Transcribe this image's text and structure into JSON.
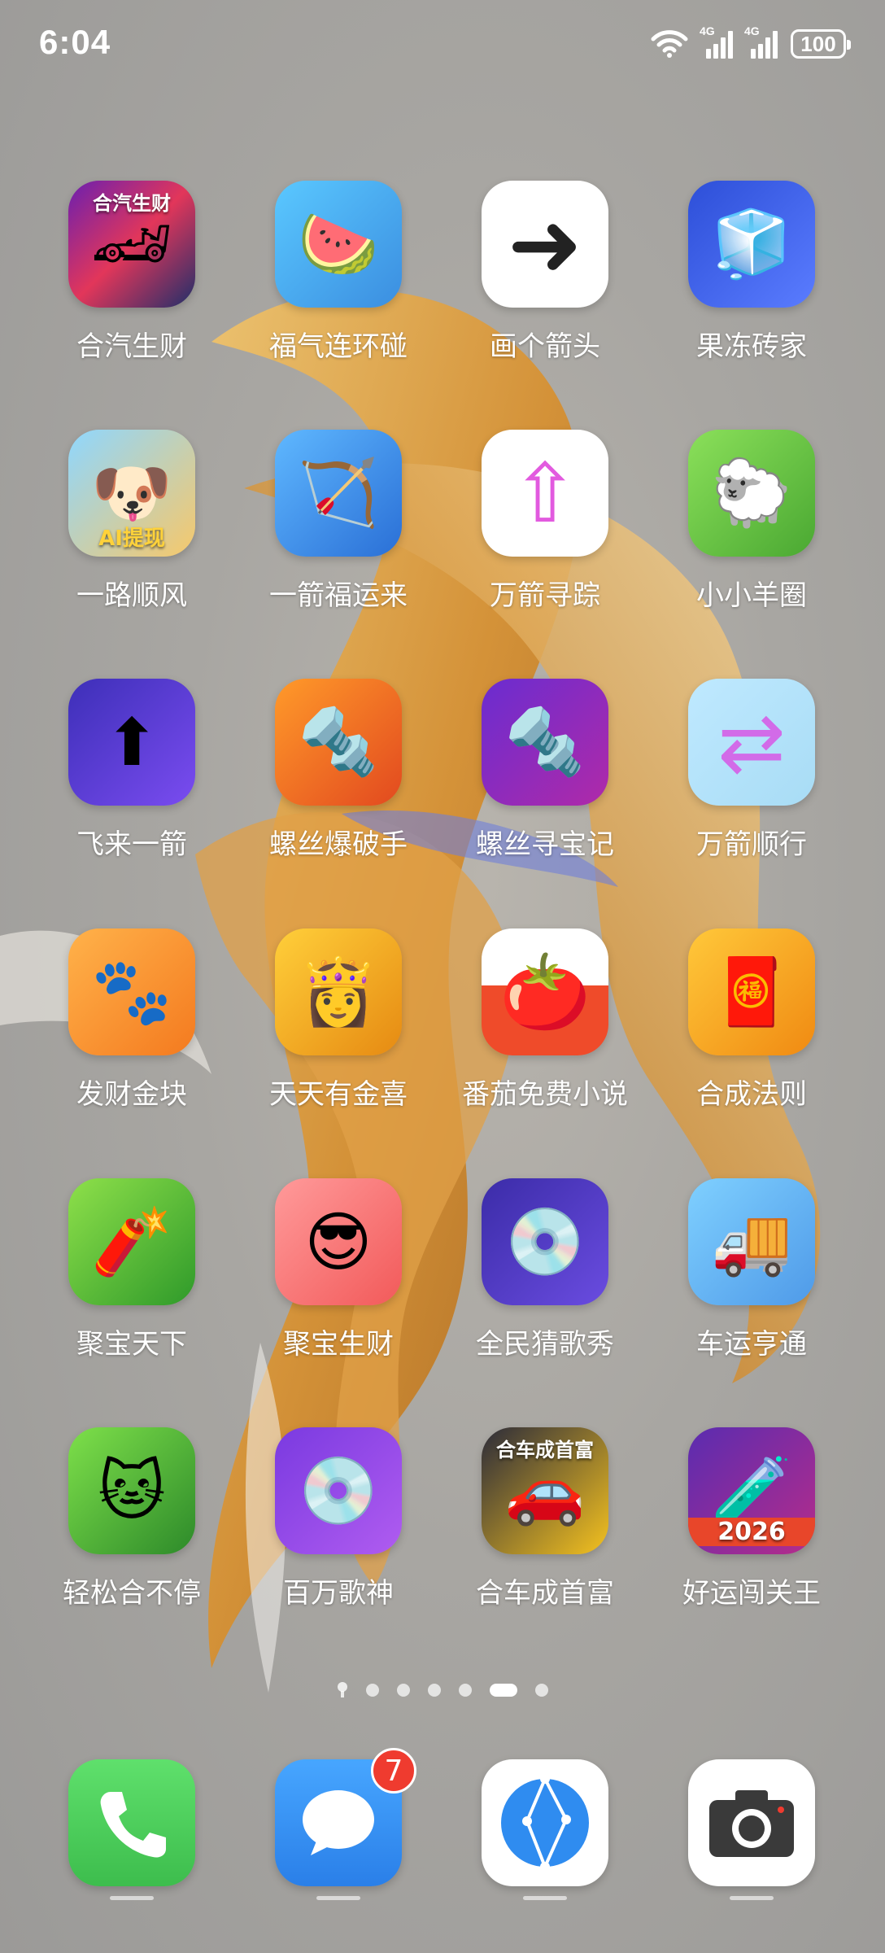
{
  "status": {
    "time": "6:04",
    "network1": "4G",
    "network2": "4G",
    "battery": "100"
  },
  "apps": [
    {
      "label": "合汽生财",
      "icon": "car-racing-icon",
      "icon_text": "合汽生财"
    },
    {
      "label": "福气连环碰",
      "icon": "watermelon-icon"
    },
    {
      "label": "画个箭头",
      "icon": "arrow-maze-icon"
    },
    {
      "label": "果冻砖家",
      "icon": "jelly-cube-icon"
    },
    {
      "label": "一路顺风",
      "icon": "animals-car-icon",
      "icon_text": "AI提现"
    },
    {
      "label": "一箭福运来",
      "icon": "arrow-ring-icon"
    },
    {
      "label": "万箭寻踪",
      "icon": "colorful-arrows-icon"
    },
    {
      "label": "小小羊圈",
      "icon": "sheep-icon"
    },
    {
      "label": "飞来一箭",
      "icon": "yellow-arrow-icon"
    },
    {
      "label": "螺丝爆破手",
      "icon": "screw-blast-icon"
    },
    {
      "label": "螺丝寻宝记",
      "icon": "screw-treasure-icon"
    },
    {
      "label": "万箭顺行",
      "icon": "arrow-grid-icon"
    },
    {
      "label": "发财金块",
      "icon": "paw-block-icon"
    },
    {
      "label": "天天有金喜",
      "icon": "lady-gold-icon"
    },
    {
      "label": "番茄免费小说",
      "icon": "tomato-book-icon"
    },
    {
      "label": "合成法则",
      "icon": "fortune-god-icon"
    },
    {
      "label": "聚宝天下",
      "icon": "fortune-man-icon"
    },
    {
      "label": "聚宝生财",
      "icon": "cool-god-icon"
    },
    {
      "label": "全民猜歌秀",
      "icon": "vinyl-music-icon"
    },
    {
      "label": "车运亨通",
      "icon": "yellow-truck-icon"
    },
    {
      "label": "轻松合不停",
      "icon": "cat-god-icon"
    },
    {
      "label": "百万歌神",
      "icon": "purple-vinyl-icon"
    },
    {
      "label": "合车成首富",
      "icon": "sports-car-icon",
      "icon_text": "合车成首富"
    },
    {
      "label": "好运闯关王",
      "icon": "tubes-2026-icon",
      "icon_text": "2026"
    }
  ],
  "dock": [
    {
      "name": "phone-app",
      "icon": "phone-icon"
    },
    {
      "name": "messages-app",
      "icon": "message-icon",
      "badge": "7"
    },
    {
      "name": "browser-app",
      "icon": "browser-icon"
    },
    {
      "name": "camera-app",
      "icon": "camera-icon"
    }
  ],
  "colors": {
    "dock_phone": "#4cd35d",
    "dock_messages": "#2f8cf0",
    "badge": "#ef3b2f"
  }
}
